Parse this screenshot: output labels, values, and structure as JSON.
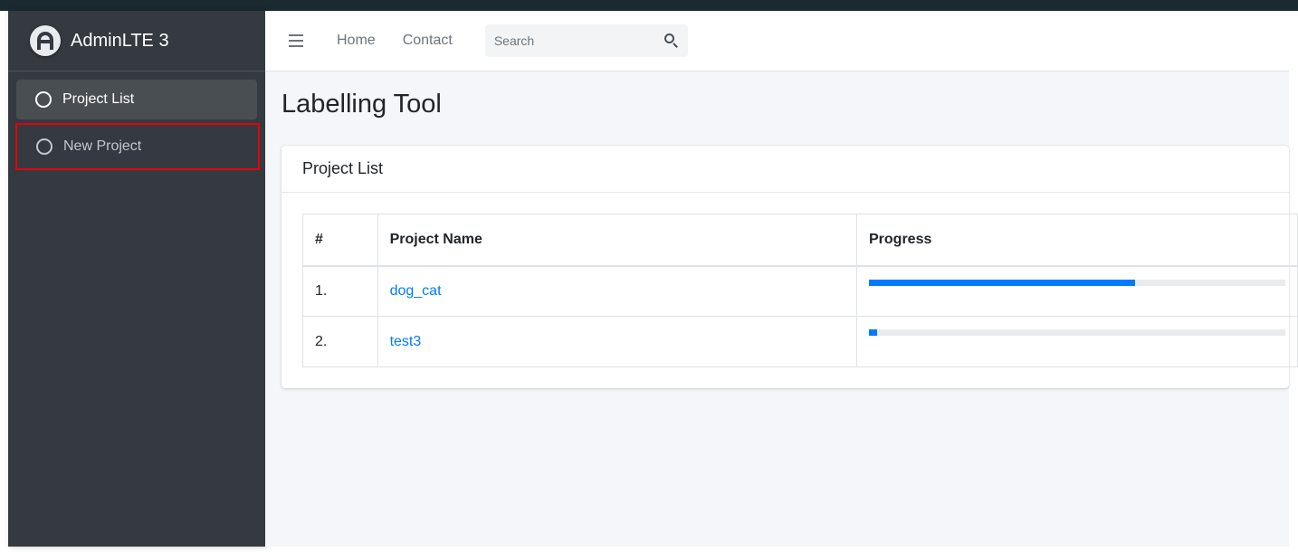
{
  "brand": {
    "name": "AdminLTE 3",
    "logo_icon": "adminlte-logo-icon"
  },
  "sidebar": {
    "items": [
      {
        "label": "Project List",
        "icon": "circle-icon",
        "active": true
      },
      {
        "label": "New Project",
        "icon": "circle-icon",
        "active": false,
        "highlighted": true
      }
    ]
  },
  "navbar": {
    "menu_icon": "hamburger-icon",
    "links": [
      "Home",
      "Contact"
    ],
    "search": {
      "placeholder": "Search",
      "value": "",
      "icon": "search-icon"
    }
  },
  "page": {
    "title": "Labelling Tool",
    "card_title": "Project List"
  },
  "table": {
    "headers": [
      "#",
      "Project Name",
      "Progress"
    ],
    "rows": [
      {
        "num": "1.",
        "name": "dog_cat",
        "progress": 0.64
      },
      {
        "num": "2.",
        "name": "test3",
        "progress": 0.02
      }
    ]
  },
  "colors": {
    "accent": "#007bff",
    "sidebar_bg": "#343a40",
    "highlight_border": "#e3000f"
  }
}
